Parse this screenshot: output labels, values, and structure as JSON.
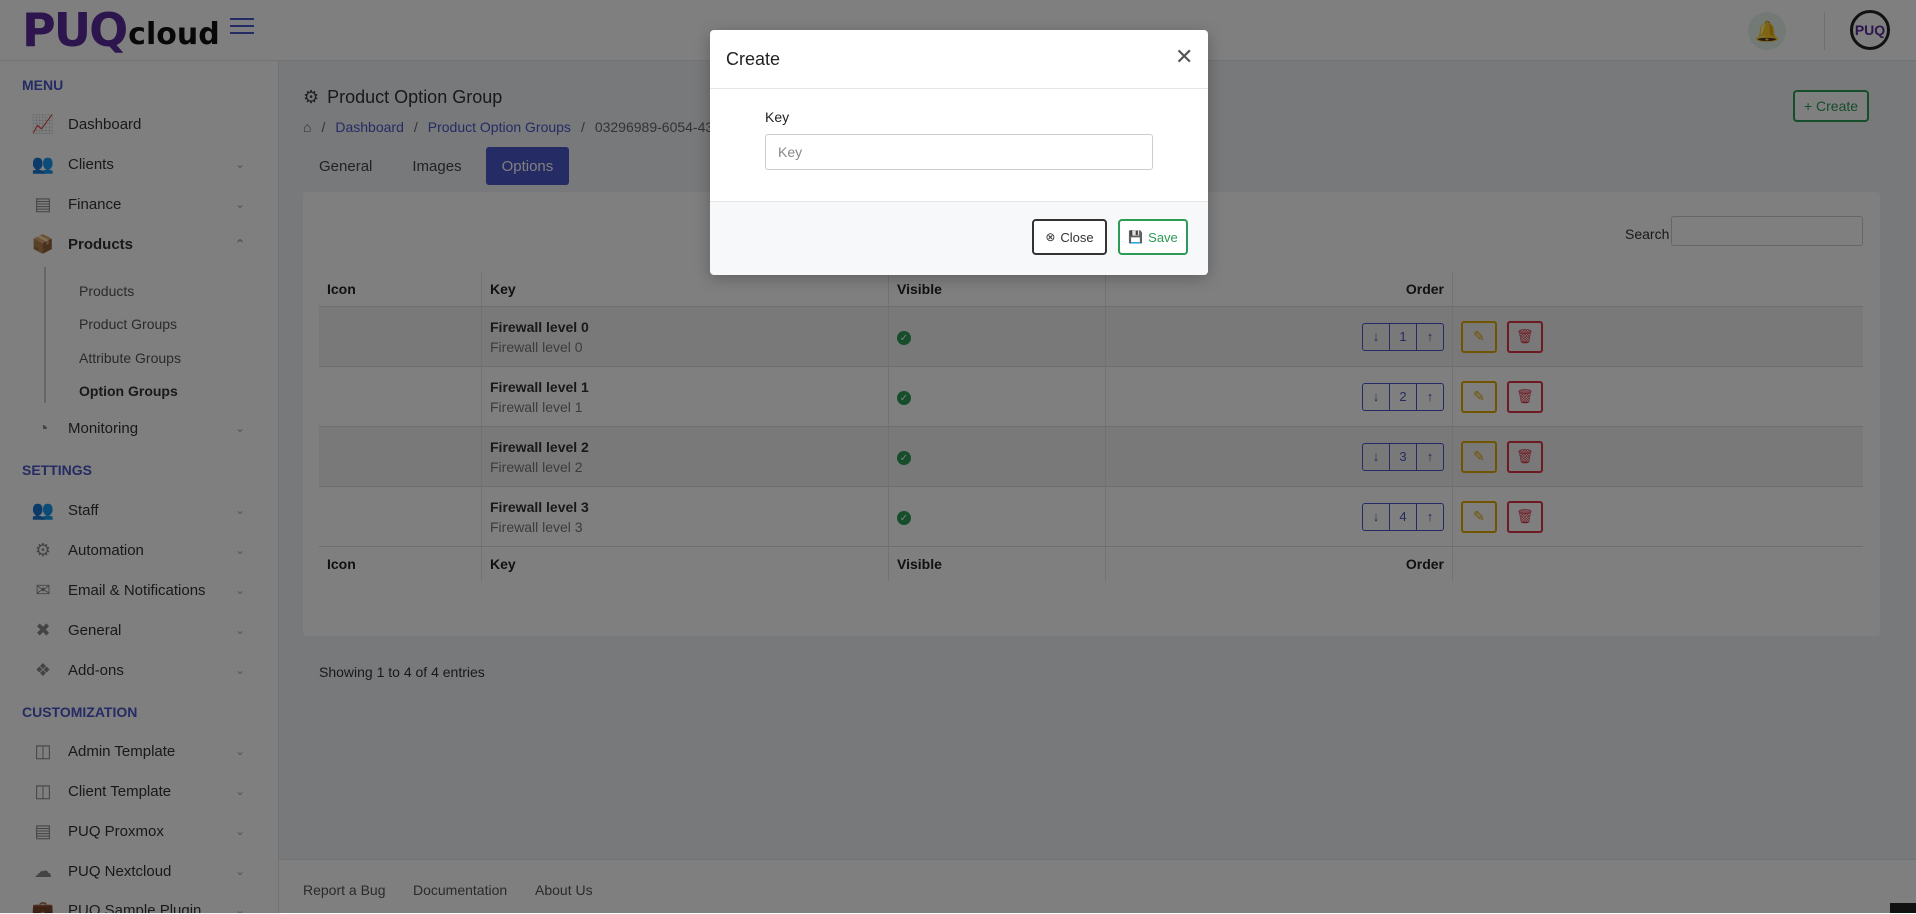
{
  "brand": {
    "logo_main": "PUQ",
    "logo_sub": "cloud",
    "avatar_text": "PUQ"
  },
  "sidebar": {
    "menu_title": "MENU",
    "menu_items": [
      {
        "label": "Dashboard",
        "icon": "chart-line-icon"
      },
      {
        "label": "Clients",
        "icon": "users-icon"
      },
      {
        "label": "Finance",
        "icon": "credit-card-icon"
      },
      {
        "label": "Products",
        "icon": "boxes-icon"
      }
    ],
    "products_sub": [
      "Products",
      "Product Groups",
      "Attribute Groups",
      "Option Groups"
    ],
    "monitoring": "Monitoring",
    "settings_title": "SETTINGS",
    "settings_items": [
      "Staff",
      "Automation",
      "Email & Notifications",
      "General",
      "Add-ons"
    ],
    "customization_title": "CUSTOMIZATION",
    "customization_items": [
      "Admin Template",
      "Client Template",
      "PUQ Proxmox",
      "PUQ Nextcloud",
      "PUQ Sample Plugin"
    ]
  },
  "header": {
    "page_title": "Product Option Group",
    "breadcrumb": [
      "Dashboard",
      "Product Option Groups",
      "03296989-6054-43"
    ],
    "create_label": "+ Create"
  },
  "tabs": [
    "General",
    "Images",
    "Options"
  ],
  "table": {
    "search_label": "Search",
    "columns": [
      "Icon",
      "Key",
      "Visible",
      "Order"
    ],
    "rows": [
      {
        "key": "Firewall level 0",
        "sub": "Firewall level 0",
        "order": "1"
      },
      {
        "key": "Firewall level 1",
        "sub": "Firewall level 1",
        "order": "2"
      },
      {
        "key": "Firewall level 2",
        "sub": "Firewall level 2",
        "order": "3"
      },
      {
        "key": "Firewall level 3",
        "sub": "Firewall level 3",
        "order": "4"
      }
    ],
    "showing": "Showing 1 to 4 of 4 entries"
  },
  "footer": [
    "Report a Bug",
    "Documentation",
    "About Us"
  ],
  "modal": {
    "title": "Create",
    "key_label": "Key",
    "key_placeholder": "Key",
    "close_label": "Close",
    "save_label": "Save"
  },
  "colors": {
    "accent": "#4a56c8",
    "success": "#2d9a55",
    "warning": "#e0a800",
    "danger": "#dc3545",
    "brand": "#5a2a9c"
  }
}
